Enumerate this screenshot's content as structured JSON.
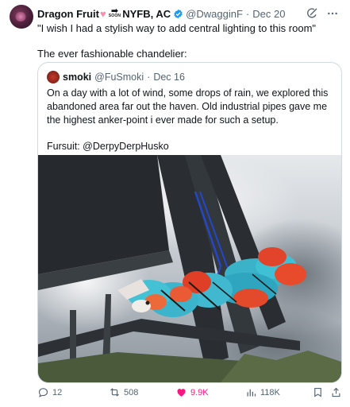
{
  "tweet": {
    "display_name": "Dragon Fruit",
    "name_suffix": "NYFB, AC",
    "soon_label": "SOON",
    "handle": "@DwagginF",
    "date": "Dec 20",
    "lines": [
      "\"I wish I had a stylish way to add central lighting to this room\"",
      "The ever fashionable chandelier:"
    ]
  },
  "quote": {
    "display_name": "smoki",
    "handle": "@FuSmoki",
    "date": "Dec 16",
    "paragraph1": "On a day with a lot of wind, some drops of rain, we explored this abandoned area far out the haven. Old industrial pipes gave me the highest anker-point i ever made for such a setup.",
    "paragraph2": "Fursuit: @DerpyDerpHusko"
  },
  "actions": {
    "replies": "12",
    "reposts": "508",
    "likes": "9.9K",
    "views": "118K"
  },
  "colors": {
    "like": "#f91880",
    "verified": "#1d9bf0",
    "muted": "#536471"
  },
  "icons": [
    "grok-icon",
    "more-icon",
    "reply-icon",
    "repost-icon",
    "like-icon",
    "views-icon",
    "bookmark-icon",
    "share-icon",
    "verified-icon",
    "heart-emoji-icon",
    "soon-arrow-icon"
  ]
}
